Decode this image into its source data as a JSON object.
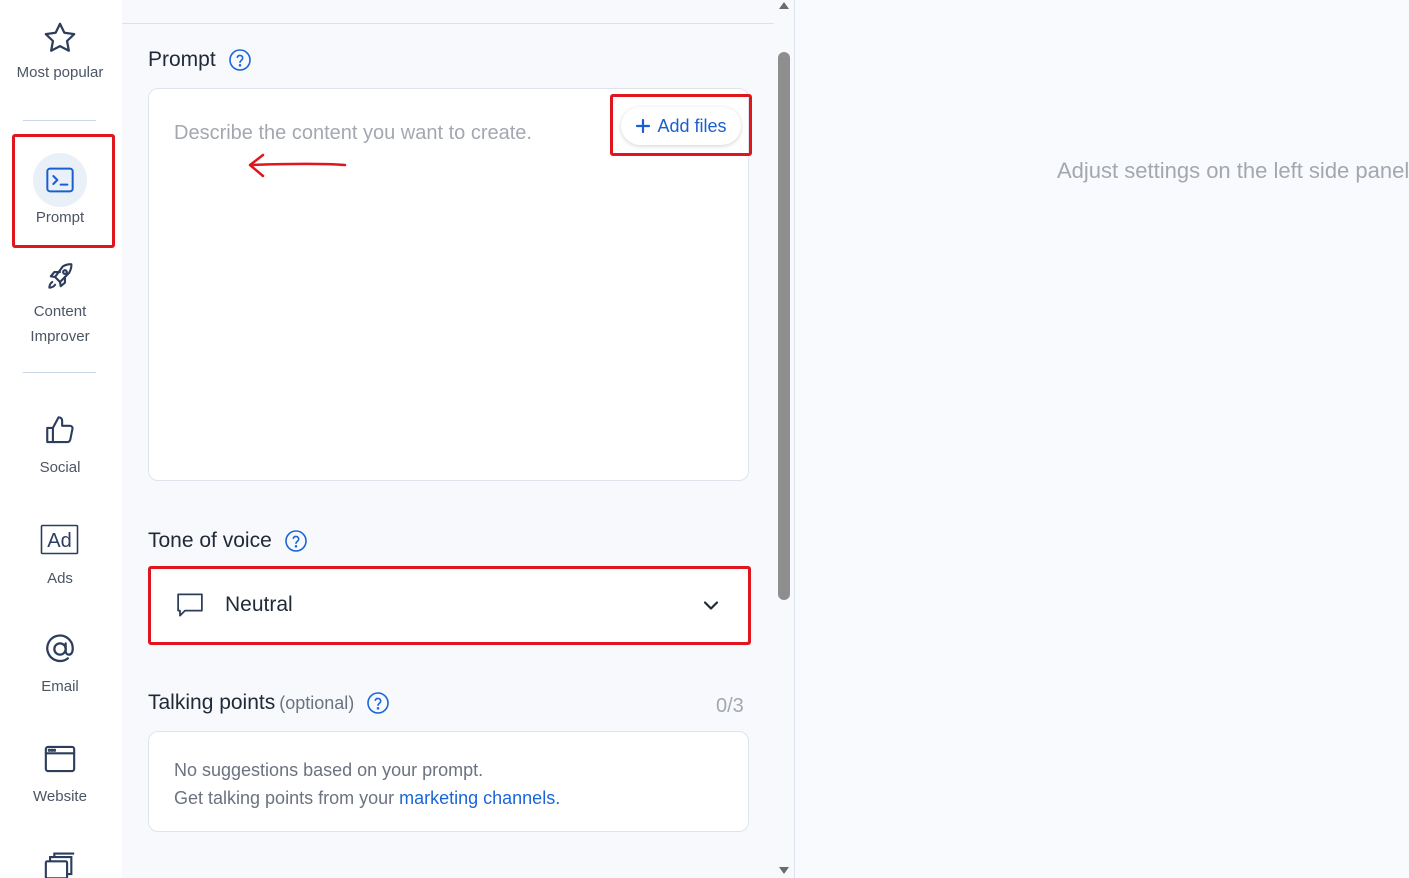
{
  "sidebar": {
    "items": [
      {
        "label": "Most popular",
        "icon": "star-icon"
      },
      {
        "label": "Prompt",
        "icon": "terminal-icon"
      },
      {
        "label_line1": "Content",
        "label_line2": "Improver",
        "icon": "rocket-icon"
      },
      {
        "label": "Social",
        "icon": "thumbs-up-icon"
      },
      {
        "label": "Ads",
        "icon": "ad-icon",
        "icon_text": "Ad"
      },
      {
        "label": "Email",
        "icon": "at-sign-icon"
      },
      {
        "label": "Website",
        "icon": "browser-window-icon"
      },
      {
        "label": "",
        "icon": "stacked-windows-icon"
      }
    ]
  },
  "prompt_section": {
    "title": "Prompt",
    "placeholder": "Describe the content you want to create.",
    "add_files_label": "Add files"
  },
  "tone_section": {
    "title": "Tone of voice",
    "selected": "Neutral"
  },
  "talking_points": {
    "title": "Talking points",
    "optional": "(optional)",
    "count": "0/3",
    "line1": "No suggestions based on your prompt.",
    "line2_prefix": "Get talking points from your ",
    "link": "marketing channels."
  },
  "preview": {
    "message": "Adjust settings on the left side panel"
  },
  "colors": {
    "accent": "#1a5fd0",
    "annotation_red": "#e0161e",
    "placeholder_gray": "#a3a8b0"
  }
}
